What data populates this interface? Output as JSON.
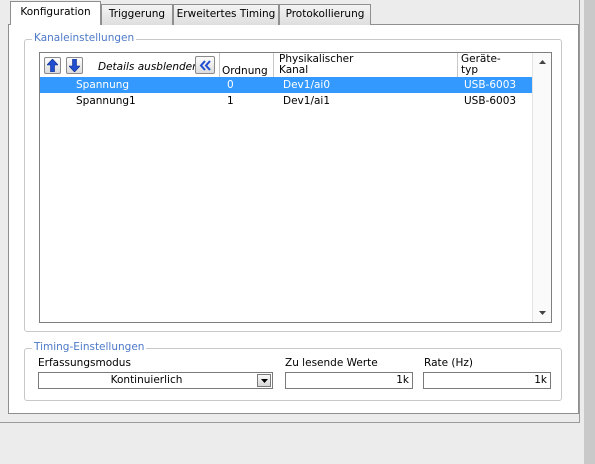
{
  "tabs": [
    {
      "label": "Konfiguration",
      "active": true
    },
    {
      "label": "Triggerung",
      "active": false
    },
    {
      "label": "Erweitertes Timing",
      "active": false
    },
    {
      "label": "Protokollierung",
      "active": false
    }
  ],
  "channel_settings": {
    "group_label": "Kanaleinstellungen",
    "toolbar": {
      "up_icon": "arrow-up-icon",
      "down_icon": "arrow-down-icon",
      "details_label": "Details ausblenden",
      "collapse_icon": "double-chevron-left-icon"
    },
    "columns": {
      "order": "Ordnung",
      "physical_line1": "Physikalischer",
      "physical_line2": "Kanal",
      "devtype_line1": "Geräte-",
      "devtype_line2": "typ"
    },
    "rows": [
      {
        "name": "Spannung",
        "order": "0",
        "channel": "Dev1/ai0",
        "device": "USB-6003",
        "selected": true
      },
      {
        "name": "Spannung1",
        "order": "1",
        "channel": "Dev1/ai1",
        "device": "USB-6003",
        "selected": false
      }
    ]
  },
  "timing_settings": {
    "group_label": "Timing-Einstellungen",
    "mode_label": "Erfassungsmodus",
    "mode_value": "Kontinuierlich",
    "samples_label": "Zu lesende Werte",
    "samples_value": "1k",
    "rate_label": "Rate (Hz)",
    "rate_value": "1k"
  },
  "colors": {
    "accent_label": "#4d79c8",
    "selection": "#3399ff",
    "arrow_icons": "#1f4fd0"
  }
}
